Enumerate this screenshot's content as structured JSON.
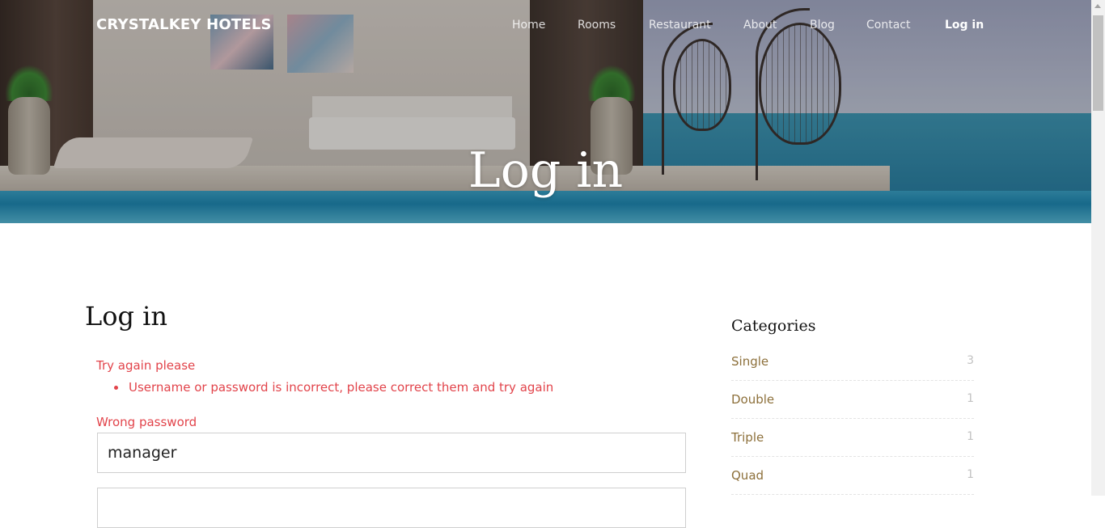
{
  "brand": "CRYSTALKEY HOTELS",
  "nav": [
    {
      "label": "Home"
    },
    {
      "label": "Rooms"
    },
    {
      "label": "Restaurant"
    },
    {
      "label": "About"
    },
    {
      "label": "Blog"
    },
    {
      "label": "Contact"
    },
    {
      "label": "Log in",
      "active": true
    }
  ],
  "hero": {
    "title": "Log in"
  },
  "main": {
    "heading": "Log in",
    "error_title": "Try again please",
    "errors": [
      "Username or password is incorrect, please correct them and try again"
    ],
    "field_label": "Wrong password",
    "username_value": "manager",
    "password_value": ""
  },
  "sidebar": {
    "title": "Categories",
    "categories": [
      {
        "name": "Single",
        "count": "3"
      },
      {
        "name": "Double",
        "count": "1"
      },
      {
        "name": "Triple",
        "count": "1"
      },
      {
        "name": "Quad",
        "count": "1"
      }
    ]
  },
  "colors": {
    "error": "#e2444b",
    "category_link": "#8d703b"
  }
}
